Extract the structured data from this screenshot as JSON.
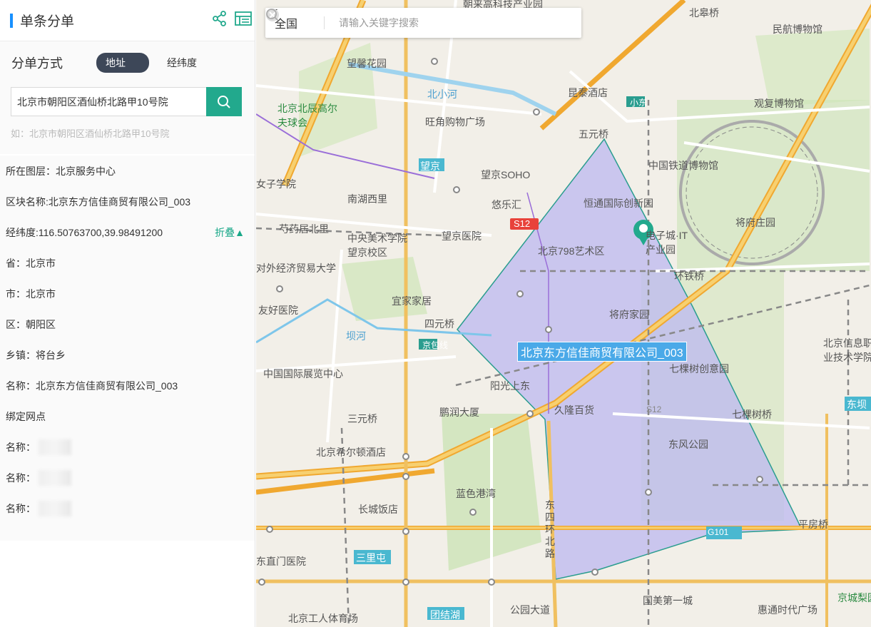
{
  "panel": {
    "title": "单条分单",
    "split_mode_label": "分单方式",
    "toggle_address": "地址",
    "toggle_latlng": "经纬度",
    "search_value": "北京市朝阳区酒仙桥北路甲10号院",
    "hint": "如：北京市朝阳区酒仙桥北路甲10号院",
    "fold_label": "折叠▲",
    "rows": [
      "所在图层：北京服务中心",
      "区块名称:北京东方信佳商贸有限公司_003",
      "经纬度:116.50763700,39.98491200",
      "省：北京市",
      "市：北京市",
      "区：朝阳区",
      "乡镇：将台乡",
      "名称：北京东方信佳商贸有限公司_003",
      "绑定网点",
      "名称：",
      "名称：",
      "名称："
    ]
  },
  "map": {
    "region": "全国",
    "search_placeholder": "请输入关键字搜索",
    "polygon_label": "北京东方信佳商贸有限公司_003",
    "labels": [
      "朝来高科技产业园",
      "北皋桥",
      "民航博物馆",
      "望馨花园",
      "北京北辰高尔夫球会",
      "昆泰酒店",
      "观复博物馆",
      "旺角购物广场",
      "北小河",
      "五元桥",
      "中国铁道博物馆",
      "望京",
      "望京SOHO",
      "悠乐汇",
      "女子学院",
      "南湖西里",
      "恒通国际创新园",
      "将府庄园",
      "芍药居北里",
      "中央美术学院望京校区",
      "望京医院",
      "北京798艺术区",
      "电子城·IT产业园",
      "对外经济贸易大学",
      "环铁桥",
      "宜家家居",
      "将府家园",
      "友好医院",
      "四元桥",
      "坝河",
      "北京信息职业技术学院",
      "中国国际展览中心",
      "七棵树创意园",
      "阳光上东",
      "久隆百货",
      "七棵树桥",
      "三元桥",
      "鹏润大厦",
      "东风公园",
      "北京希尔顿酒店",
      "蓝色港湾",
      "长城饭店",
      "东四环北路",
      "平房桥",
      "京城梨园",
      "三里屯",
      "东直门医院",
      "北京工人体育场",
      "团结湖",
      "公园大道",
      "国美第一城",
      "惠通时代广场",
      "东坝",
      "G101",
      "S12",
      "S12",
      "小东",
      "京包线"
    ]
  },
  "colors": {
    "accent": "#1890ff",
    "search_btn": "#22a98d",
    "polygon_fill": "#bcb8f0",
    "polygon_stroke": "#2a9d8f",
    "label_bg": "#4aa9e8",
    "toggle_on": "#3d4758"
  }
}
